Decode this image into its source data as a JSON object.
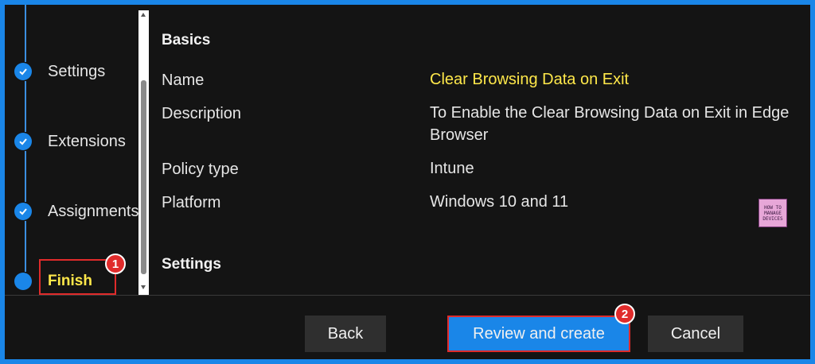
{
  "wizard": {
    "steps": [
      {
        "label": "Settings",
        "state": "complete"
      },
      {
        "label": "Extensions",
        "state": "complete"
      },
      {
        "label": "Assignments",
        "state": "complete"
      },
      {
        "label": "Finish",
        "state": "current"
      }
    ]
  },
  "basics": {
    "title": "Basics",
    "rows": [
      {
        "label": "Name",
        "value": "Clear Browsing Data on Exit"
      },
      {
        "label": "Description",
        "value": "To Enable the Clear Browsing Data on Exit in Edge Browser"
      },
      {
        "label": "Policy type",
        "value": "Intune"
      },
      {
        "label": "Platform",
        "value": "Windows 10 and 11"
      }
    ]
  },
  "settings_section": {
    "title": "Settings"
  },
  "logo": {
    "line1": "HOW TO",
    "line2": "MANAGE",
    "line3": "DEVICES"
  },
  "footer": {
    "back_label": "Back",
    "review_label": "Review and create",
    "cancel_label": "Cancel"
  },
  "annotations": {
    "badge1": "1",
    "badge2": "2"
  },
  "colors": {
    "accent": "#1a86e8",
    "highlight": "#ffe84a",
    "callout": "#e02b2b",
    "background": "#141414"
  }
}
